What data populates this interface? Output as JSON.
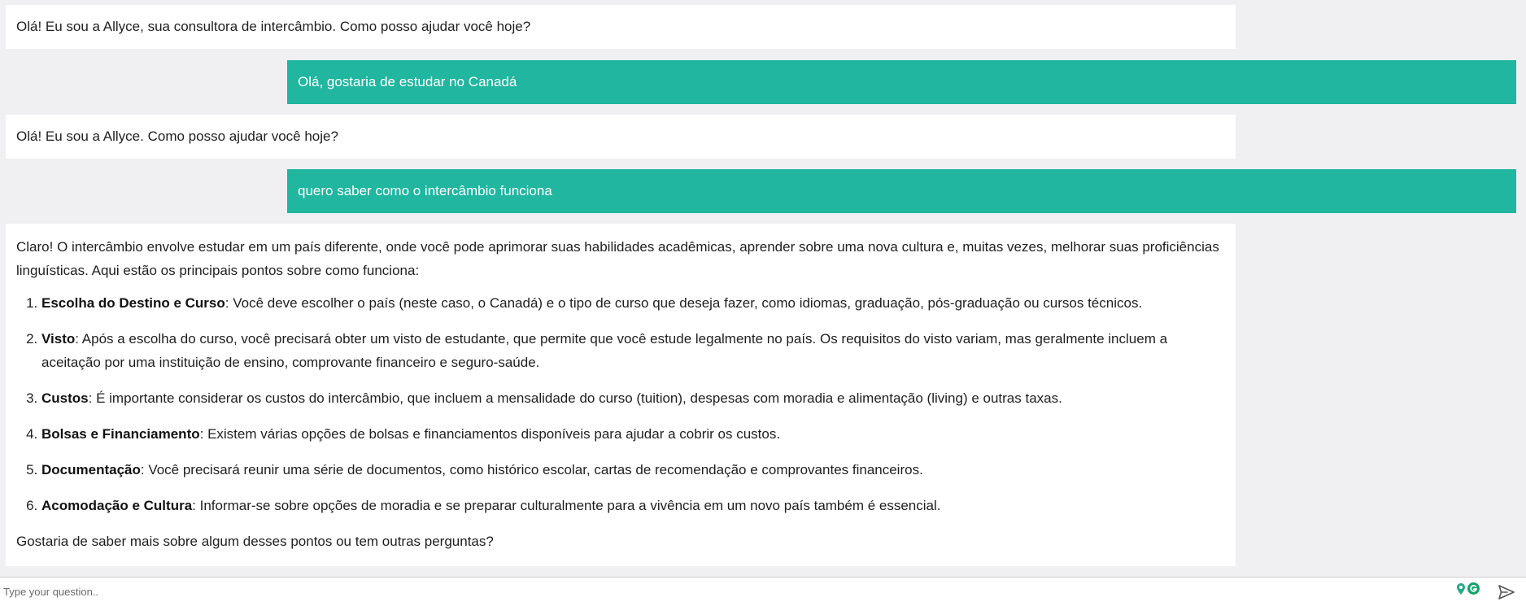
{
  "messages": [
    {
      "role": "bot",
      "text": "Olá! Eu sou a Allyce, sua consultora de intercâmbio. Como posso ajudar você hoje?"
    },
    {
      "role": "user",
      "text": "Olá, gostaria de estudar no Canadá"
    },
    {
      "role": "bot",
      "text": "Olá! Eu sou a Allyce. Como posso ajudar você hoje?"
    },
    {
      "role": "user",
      "text": "quero saber como o intercâmbio funciona"
    },
    {
      "role": "bot",
      "intro": "Claro! O intercâmbio envolve estudar em um país diferente, onde você pode aprimorar suas habilidades acadêmicas, aprender sobre uma nova cultura e, muitas vezes, melhorar suas proficiências linguísticas. Aqui estão os principais pontos sobre como funciona:",
      "items": [
        {
          "title": "Escolha do Destino e Curso",
          "text": ": Você deve escolher o país (neste caso, o Canadá) e o tipo de curso que deseja fazer, como idiomas, graduação, pós-graduação ou cursos técnicos."
        },
        {
          "title": "Visto",
          "text": ": Após a escolha do curso, você precisará obter um visto de estudante, que permite que você estude legalmente no país. Os requisitos do visto variam, mas geralmente incluem a aceitação por uma instituição de ensino, comprovante financeiro e seguro-saúde."
        },
        {
          "title": "Custos",
          "text": ": É importante considerar os custos do intercâmbio, que incluem a mensalidade do curso (tuition), despesas com moradia e alimentação (living) e outras taxas."
        },
        {
          "title": "Bolsas e Financiamento",
          "text": ": Existem várias opções de bolsas e financiamentos disponíveis para ajudar a cobrir os custos."
        },
        {
          "title": "Documentação",
          "text": ": Você precisará reunir uma série de documentos, como histórico escolar, cartas de recomendação e comprovantes financeiros."
        },
        {
          "title": "Acomodação e Cultura",
          "text": ": Informar-se sobre opções de moradia e se preparar culturalmente para a vivência em um novo país também é essencial."
        }
      ],
      "closing": "Gostaria de saber mais sobre algum desses pontos ou tem outras perguntas?"
    }
  ],
  "input": {
    "placeholder": "Type your question..",
    "value": ""
  },
  "icons": {
    "location": "location-pin-icon",
    "grammar": "grammarly-icon",
    "send": "send-icon"
  },
  "colors": {
    "user_bubble": "#20b69f",
    "bot_bubble": "#ffffff",
    "background": "#f0f0f2"
  }
}
